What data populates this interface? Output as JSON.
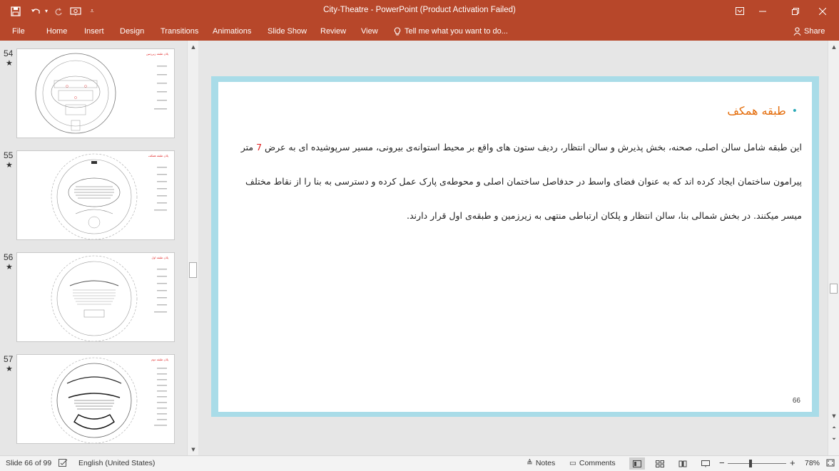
{
  "app": {
    "window_title": "City-Theatre - PowerPoint (Product Activation Failed)"
  },
  "quick_access": {
    "save_icon": "save-icon",
    "undo_icon": "undo-icon",
    "redo_icon": "redo-icon",
    "present_icon": "present-from-beginning-icon",
    "customize_icon": "customize-toolbar-icon"
  },
  "ribbon": {
    "tabs": [
      {
        "label": "File"
      },
      {
        "label": "Home"
      },
      {
        "label": "Insert"
      },
      {
        "label": "Design"
      },
      {
        "label": "Transitions"
      },
      {
        "label": "Animations"
      },
      {
        "label": "Slide Show"
      },
      {
        "label": "Review"
      },
      {
        "label": "View"
      }
    ],
    "tell_me": "Tell me what you want to do...",
    "share": "Share"
  },
  "thumbnails": [
    {
      "number": "54",
      "star": "★",
      "title": "پلان طبقه زیرزمین"
    },
    {
      "number": "55",
      "star": "★",
      "title": "پلان طبقه همکف"
    },
    {
      "number": "56",
      "star": "★",
      "title": "پلان طبقه اول"
    },
    {
      "number": "57",
      "star": "★",
      "title": "پلان طبقه دوم"
    }
  ],
  "slide": {
    "heading": "طبقه همکف",
    "bullet": "•",
    "line1_pre": "این طبقه شامل سالن اصلی، صحنه، بخش پذیرش و سالن انتظار، ردیف ستون های واقع بر محیط استوانه‌ی بیرونی، مسیر سرپوشیده ای به عرض ",
    "line1_num": "7",
    "line1_post": " متر",
    "line2": "پیرامون ساختمان ایجاد کرده اند که به عنوان فضای واسط در حدفاصل ساختمان اصلی و محوطه‌ی پارک عمل کرده و دسترسی به بنا را از نقاط مختلف",
    "line3": "میسر میکنند. در بخش شمالی بنا، سالن انتظار و پلکان ارتباطی منتهی به زیرزمین و طبقه‌ی اول قرار دارند.",
    "page_number": "66"
  },
  "status": {
    "slide_indicator": "Slide 66 of 99",
    "language": "English (United States)",
    "notes": "Notes",
    "comments": "Comments",
    "zoom": "78%"
  },
  "colors": {
    "accent": "#b7472a",
    "slide_border": "#a9dce8",
    "heading": "#e46c0a",
    "bullet": "#2aa9b7",
    "highlight_number": "#e02020"
  }
}
